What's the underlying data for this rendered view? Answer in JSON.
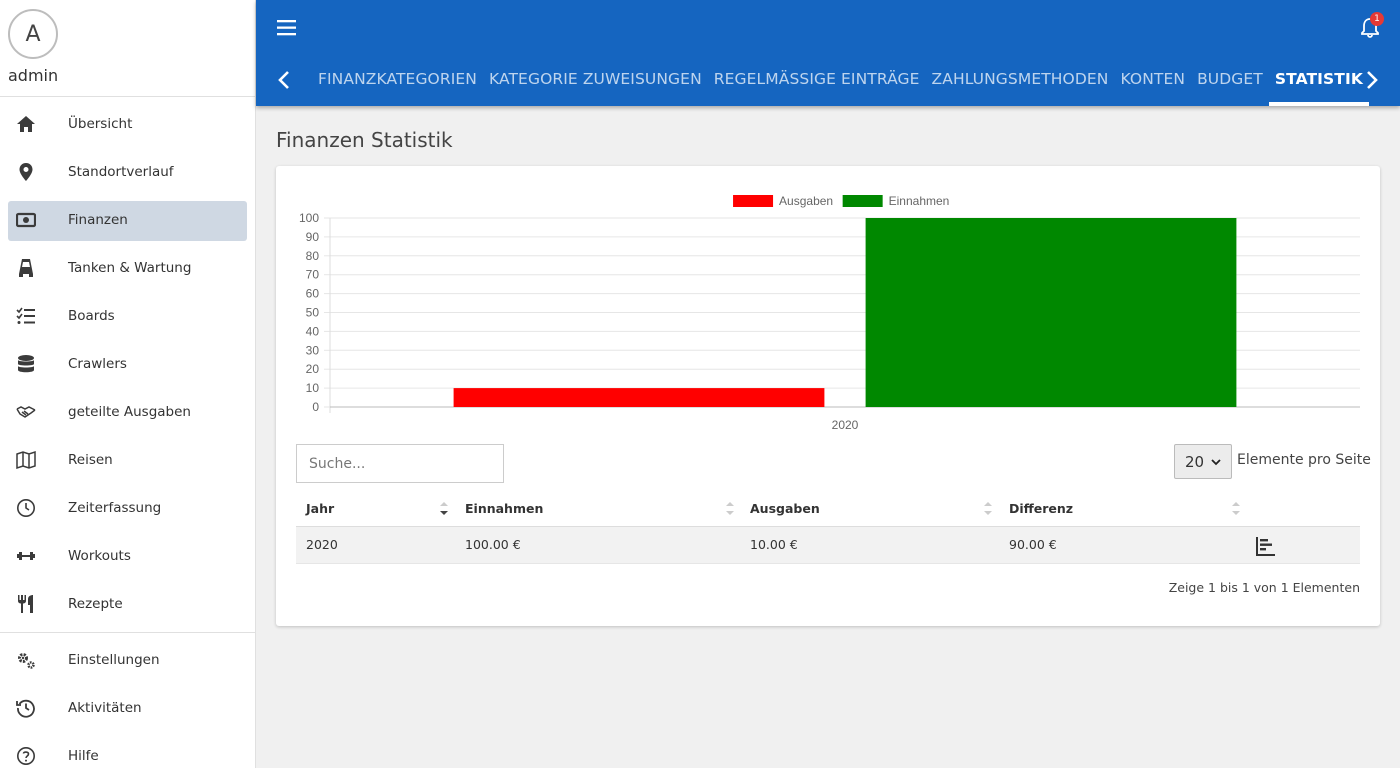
{
  "user": {
    "avatar_letter": "A",
    "name": "admin"
  },
  "sidebar": {
    "items": [
      {
        "label": "Übersicht",
        "icon": "home-icon"
      },
      {
        "label": "Standortverlauf",
        "icon": "map-pin-icon"
      },
      {
        "label": "Finanzen",
        "icon": "money-icon",
        "active": true
      },
      {
        "label": "Tanken & Wartung",
        "icon": "car-icon"
      },
      {
        "label": "Boards",
        "icon": "checklist-icon"
      },
      {
        "label": "Crawlers",
        "icon": "database-icon"
      },
      {
        "label": "geteilte Ausgaben",
        "icon": "handshake-icon"
      },
      {
        "label": "Reisen",
        "icon": "map-icon"
      },
      {
        "label": "Zeiterfassung",
        "icon": "clock-icon"
      },
      {
        "label": "Workouts",
        "icon": "dumbbell-icon"
      },
      {
        "label": "Rezepte",
        "icon": "utensils-icon"
      }
    ],
    "bottom_items": [
      {
        "label": "Einstellungen",
        "icon": "cogs-icon"
      },
      {
        "label": "Aktivitäten",
        "icon": "history-icon"
      },
      {
        "label": "Hilfe",
        "icon": "help-icon"
      }
    ]
  },
  "header": {
    "notification_count": "1",
    "tabs": [
      {
        "label": "Finanzkategorien"
      },
      {
        "label": "Kategorie Zuweisungen"
      },
      {
        "label": "Regelmässige Einträge"
      },
      {
        "label": "Zahlungsmethoden"
      },
      {
        "label": "Konten"
      },
      {
        "label": "Budget"
      },
      {
        "label": "Statistik",
        "active": true
      }
    ]
  },
  "page": {
    "title": "Finanzen Statistik"
  },
  "chart_data": {
    "type": "bar",
    "categories": [
      "2020"
    ],
    "series": [
      {
        "name": "Ausgaben",
        "color": "#ff0000",
        "values": [
          10
        ]
      },
      {
        "name": "Einnahmen",
        "color": "#008800",
        "values": [
          100
        ]
      }
    ],
    "yticks": [
      0,
      10,
      20,
      30,
      40,
      50,
      60,
      70,
      80,
      90,
      100
    ],
    "ylim": [
      0,
      100
    ],
    "legend": "top-center",
    "grid": true
  },
  "table": {
    "search_placeholder": "Suche...",
    "per_page_value": "20",
    "per_page_label": "Elemente pro Seite",
    "columns": [
      "Jahr",
      "Einnahmen",
      "Ausgaben",
      "Differenz"
    ],
    "rows": [
      {
        "jahr": "2020",
        "einnahmen": "100.00 €",
        "ausgaben": "10.00 €",
        "differenz": "90.00 €"
      }
    ],
    "info": "Zeige 1 bis 1 von 1 Elementen"
  }
}
